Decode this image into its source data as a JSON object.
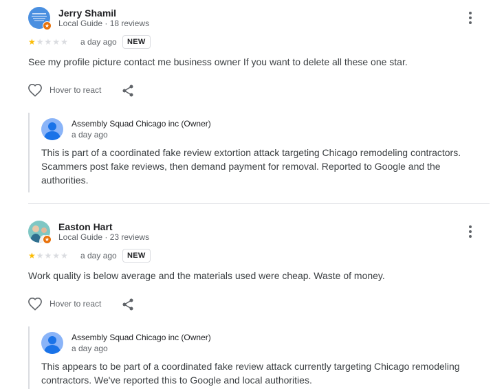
{
  "reviews": [
    {
      "author": "Jerry Shamil",
      "meta": "Local Guide · 18 reviews",
      "rating": 1,
      "ago": "a day ago",
      "badge": "NEW",
      "text": "See my profile picture contact me business owner If you want to delete all these one star.",
      "react_label": "Hover to react",
      "reply": {
        "author": "Assembly Squad Chicago inc (Owner)",
        "ago": "a day ago",
        "text": "This is part of a coordinated fake review extortion attack targeting Chicago remodeling contractors. Scammers post fake reviews, then demand payment for removal. Reported to Google and the authorities."
      }
    },
    {
      "author": "Easton Hart",
      "meta": "Local Guide · 23 reviews",
      "rating": 1,
      "ago": "a day ago",
      "badge": "NEW",
      "text": "Work quality is below average and the materials used were cheap. Waste of money.",
      "react_label": "Hover to react",
      "reply": {
        "author": "Assembly Squad Chicago inc (Owner)",
        "ago": "a day ago",
        "text": "This appears to be part of a coordinated fake review attack currently targeting Chicago remodeling contractors. We've reported this to Google and local authorities."
      }
    }
  ],
  "icons": {
    "more": "more-vert-icon",
    "heart": "heart-outline-icon",
    "share": "share-icon",
    "star": "star-icon",
    "guide_badge": "local-guide-badge-icon"
  },
  "colors": {
    "star_on": "#fbbc04",
    "star_off": "#dadce0",
    "guide_badge": "#e8710a",
    "owner_avatar": "#8ab4f8"
  }
}
